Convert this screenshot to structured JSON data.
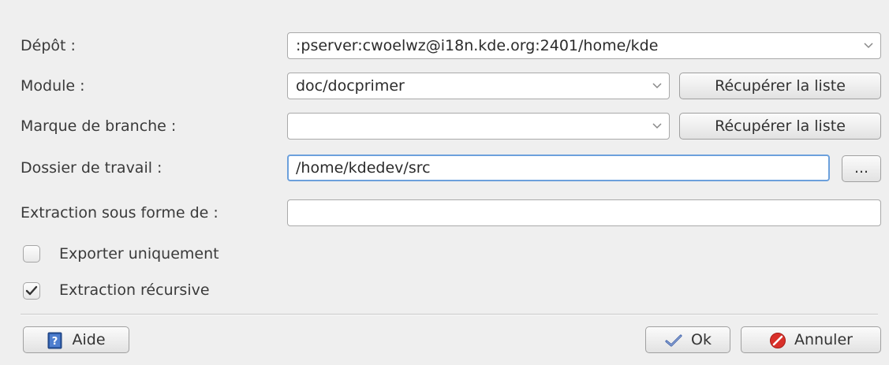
{
  "form": {
    "depot": {
      "label": "Dépôt :",
      "value": ":pserver:cwoelwz@i18n.kde.org:2401/home/kde"
    },
    "module": {
      "label": "Module :",
      "value": "doc/docprimer",
      "fetch_button": "Récupérer la liste"
    },
    "branche": {
      "label": "Marque de branche :",
      "value": "",
      "fetch_button": "Récupérer la liste"
    },
    "dossier": {
      "label": "Dossier de travail :",
      "value": "/home/kdedev/src",
      "browse_button": "..."
    },
    "extraction": {
      "label": "Extraction sous forme de :",
      "value": ""
    },
    "exporter": {
      "label": "Exporter uniquement",
      "checked": false
    },
    "recursive": {
      "label": "Extraction récursive",
      "checked": true
    }
  },
  "footer": {
    "help_label": "Aide",
    "ok_label": "Ok",
    "cancel_label": "Annuler"
  },
  "icons": {
    "help": "help-book-icon",
    "ok": "checkmark-icon",
    "cancel": "cancel-icon"
  },
  "colors": {
    "accent_focus": "#6ca0dc",
    "ok_blue": "#3d5fa8",
    "cancel_red": "#d9302a"
  }
}
